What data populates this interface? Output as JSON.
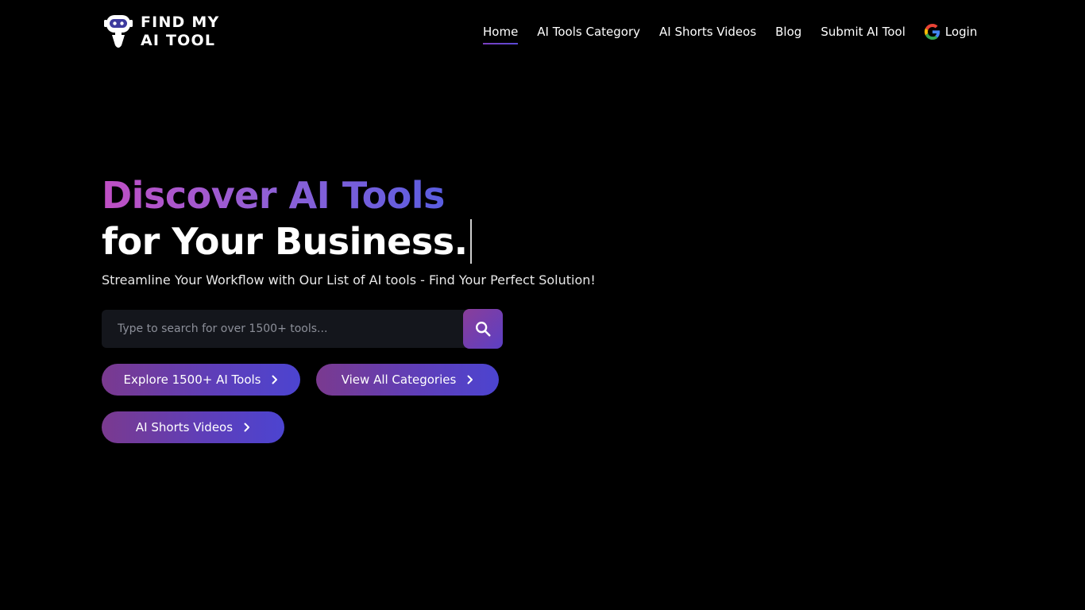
{
  "brand": {
    "logo_icon": "robot-icon",
    "name_line1": "FIND MY",
    "name_line2": "AI TOOL"
  },
  "nav": {
    "items": [
      {
        "label": "Home",
        "active": true
      },
      {
        "label": "AI Tools Category"
      },
      {
        "label": "AI Shorts Videos"
      },
      {
        "label": "Blog"
      },
      {
        "label": "Submit AI Tool"
      }
    ],
    "login": {
      "label": "Login",
      "icon": "google-icon"
    }
  },
  "hero": {
    "headline_gradient": "Discover AI Tools",
    "headline_plain": "for Your Business.",
    "subtitle": "Streamline Your Workflow with Our List of AI tools - Find Your Perfect Solution!"
  },
  "search": {
    "value": "",
    "placeholder": "Type to search for over 1500+ tools...",
    "button_icon": "search-icon"
  },
  "cta": {
    "explore": "Explore 1500+ AI Tools",
    "categories": "View All Categories",
    "shorts": "AI Shorts Videos"
  },
  "colors": {
    "background": "#000000",
    "accent_start": "#c04fc4",
    "accent_end": "#5a5de0",
    "button_start": "#7a3a8f",
    "button_end": "#4c44d0"
  }
}
